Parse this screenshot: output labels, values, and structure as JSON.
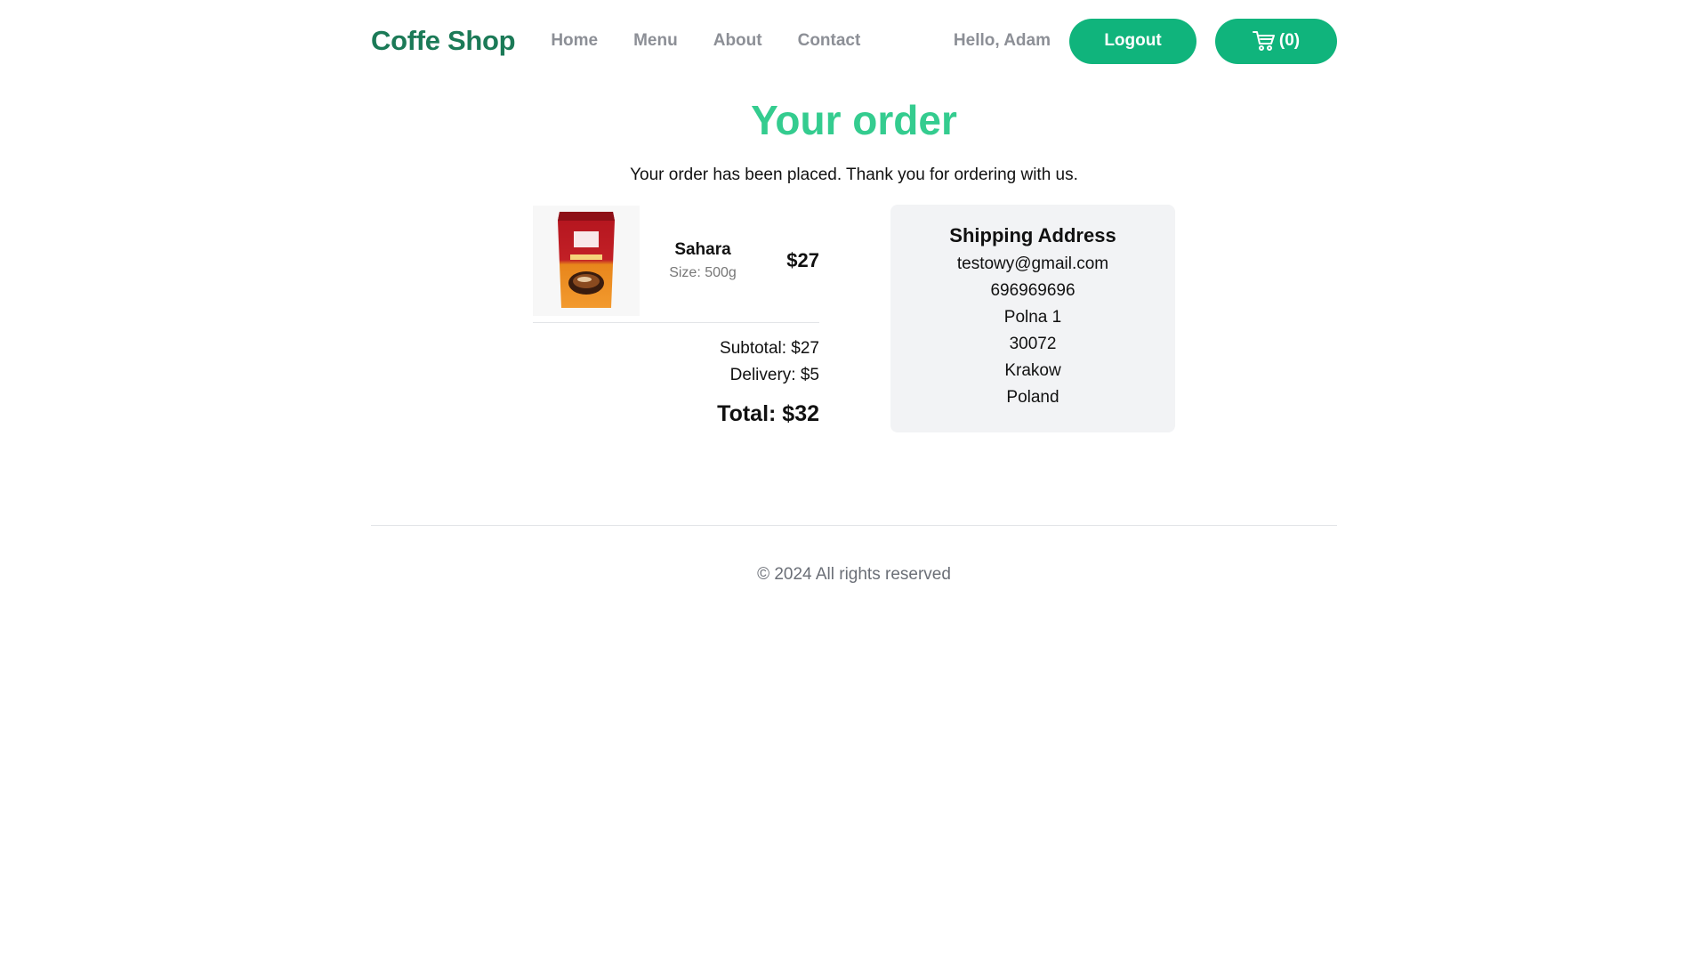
{
  "header": {
    "brand": "Coffe Shop",
    "nav": [
      {
        "label": "Home"
      },
      {
        "label": "Menu"
      },
      {
        "label": "About"
      },
      {
        "label": "Contact"
      }
    ],
    "greeting": "Hello, Adam",
    "logout_label": "Logout",
    "cart_label": "(0)",
    "cart_icon": "shopping-cart-icon"
  },
  "main": {
    "title": "Your order",
    "message": "Your order has been placed. Thank you for ordering with us.",
    "items": [
      {
        "name": "Sahara",
        "size": "Size: 500g",
        "price": "$27",
        "image": "coffee-bag-image"
      }
    ],
    "subtotal": "Subtotal: $27",
    "delivery": "Delivery: $5",
    "total": "Total: $32"
  },
  "shipping": {
    "title": "Shipping Address",
    "email": "testowy@gmail.com",
    "phone": "696969696",
    "street": "Polna 1",
    "postal_code": "30072",
    "city": "Krakow",
    "country": "Poland"
  },
  "footer": {
    "text": "© 2024 All rights reserved"
  },
  "colors": {
    "brand": "#1b7a57",
    "accent": "#10b47c",
    "title": "#34cc8f",
    "muted": "#8c8f96",
    "box_bg": "#f2f3f5"
  }
}
